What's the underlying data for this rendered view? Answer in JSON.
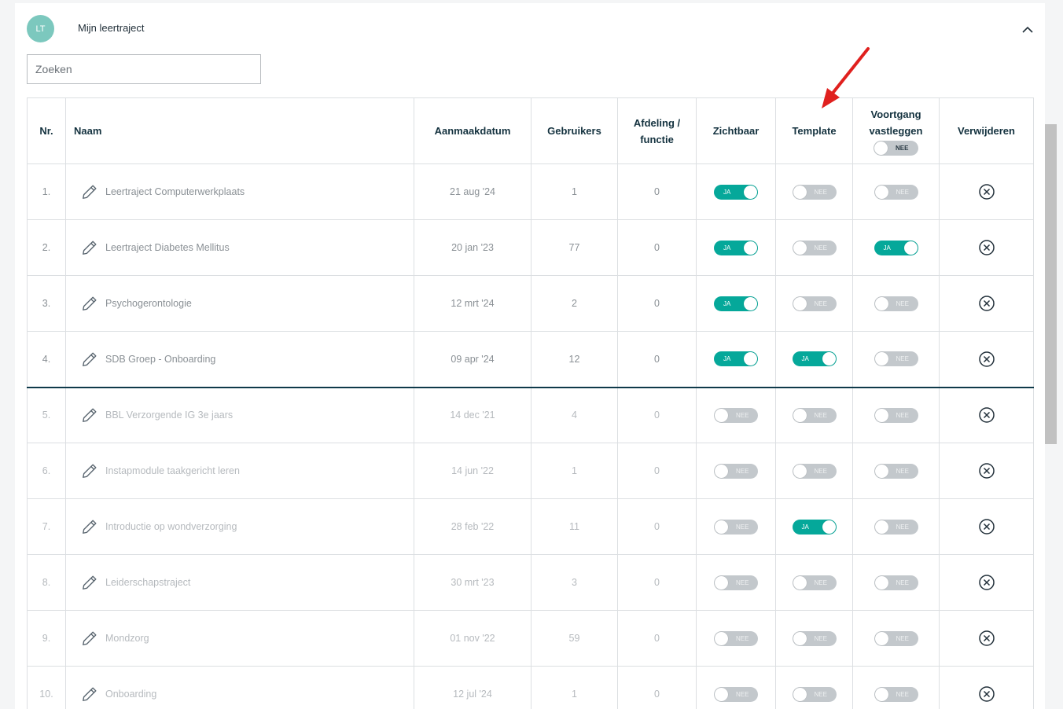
{
  "header": {
    "avatar": "LT",
    "title": "Mijn leertraject"
  },
  "search": {
    "placeholder": "Zoeken",
    "value": ""
  },
  "columns": {
    "nr": "Nr.",
    "naam": "Naam",
    "aanmaakdatum": "Aanmaakdatum",
    "gebruikers": "Gebruikers",
    "afdeling_line1": "Afdeling /",
    "afdeling_line2": "functie",
    "zichtbaar": "Zichtbaar",
    "template": "Template",
    "voortgang_line1": "Voortgang",
    "voortgang_line2": "vastleggen",
    "voortgang_toggle": "NEE",
    "verwijderen": "Verwijderen"
  },
  "toggle_labels": {
    "on": "JA",
    "off": "NEE"
  },
  "rows": [
    {
      "nr": "1.",
      "naam": "Leertraject Computerwerkplaats",
      "datum": "21 aug '24",
      "gebruikers": "1",
      "afdeling": "0",
      "zichtbaar": true,
      "template": false,
      "voortgang": false
    },
    {
      "nr": "2.",
      "naam": "Leertraject Diabetes Mellitus",
      "datum": "20 jan '23",
      "gebruikers": "77",
      "afdeling": "0",
      "zichtbaar": true,
      "template": false,
      "voortgang": true
    },
    {
      "nr": "3.",
      "naam": "Psychogerontologie",
      "datum": "12 mrt '24",
      "gebruikers": "2",
      "afdeling": "0",
      "zichtbaar": true,
      "template": false,
      "voortgang": false
    },
    {
      "nr": "4.",
      "naam": "SDB Groep - Onboarding",
      "datum": "09 apr '24",
      "gebruikers": "12",
      "afdeling": "0",
      "zichtbaar": true,
      "template": true,
      "voortgang": false
    },
    {
      "nr": "5.",
      "naam": "BBL Verzorgende IG 3e jaars",
      "datum": "14 dec '21",
      "gebruikers": "4",
      "afdeling": "0",
      "zichtbaar": false,
      "template": false,
      "voortgang": false
    },
    {
      "nr": "6.",
      "naam": "Instapmodule taakgericht leren",
      "datum": "14 jun '22",
      "gebruikers": "1",
      "afdeling": "0",
      "zichtbaar": false,
      "template": false,
      "voortgang": false
    },
    {
      "nr": "7.",
      "naam": "Introductie op wondverzorging",
      "datum": "28 feb '22",
      "gebruikers": "11",
      "afdeling": "0",
      "zichtbaar": false,
      "template": true,
      "voortgang": false
    },
    {
      "nr": "8.",
      "naam": "Leiderschapstraject",
      "datum": "30 mrt '23",
      "gebruikers": "3",
      "afdeling": "0",
      "zichtbaar": false,
      "template": false,
      "voortgang": false
    },
    {
      "nr": "9.",
      "naam": "Mondzorg",
      "datum": "01 nov '22",
      "gebruikers": "59",
      "afdeling": "0",
      "zichtbaar": false,
      "template": false,
      "voortgang": false
    },
    {
      "nr": "10.",
      "naam": "Onboarding",
      "datum": "12 jul '24",
      "gebruikers": "1",
      "afdeling": "0",
      "zichtbaar": false,
      "template": false,
      "voortgang": false
    }
  ],
  "colors": {
    "accent": "#05a89a",
    "toggle_off": "#c3c8cc",
    "annotation_arrow": "#e0201e",
    "heading": "#14323f"
  }
}
